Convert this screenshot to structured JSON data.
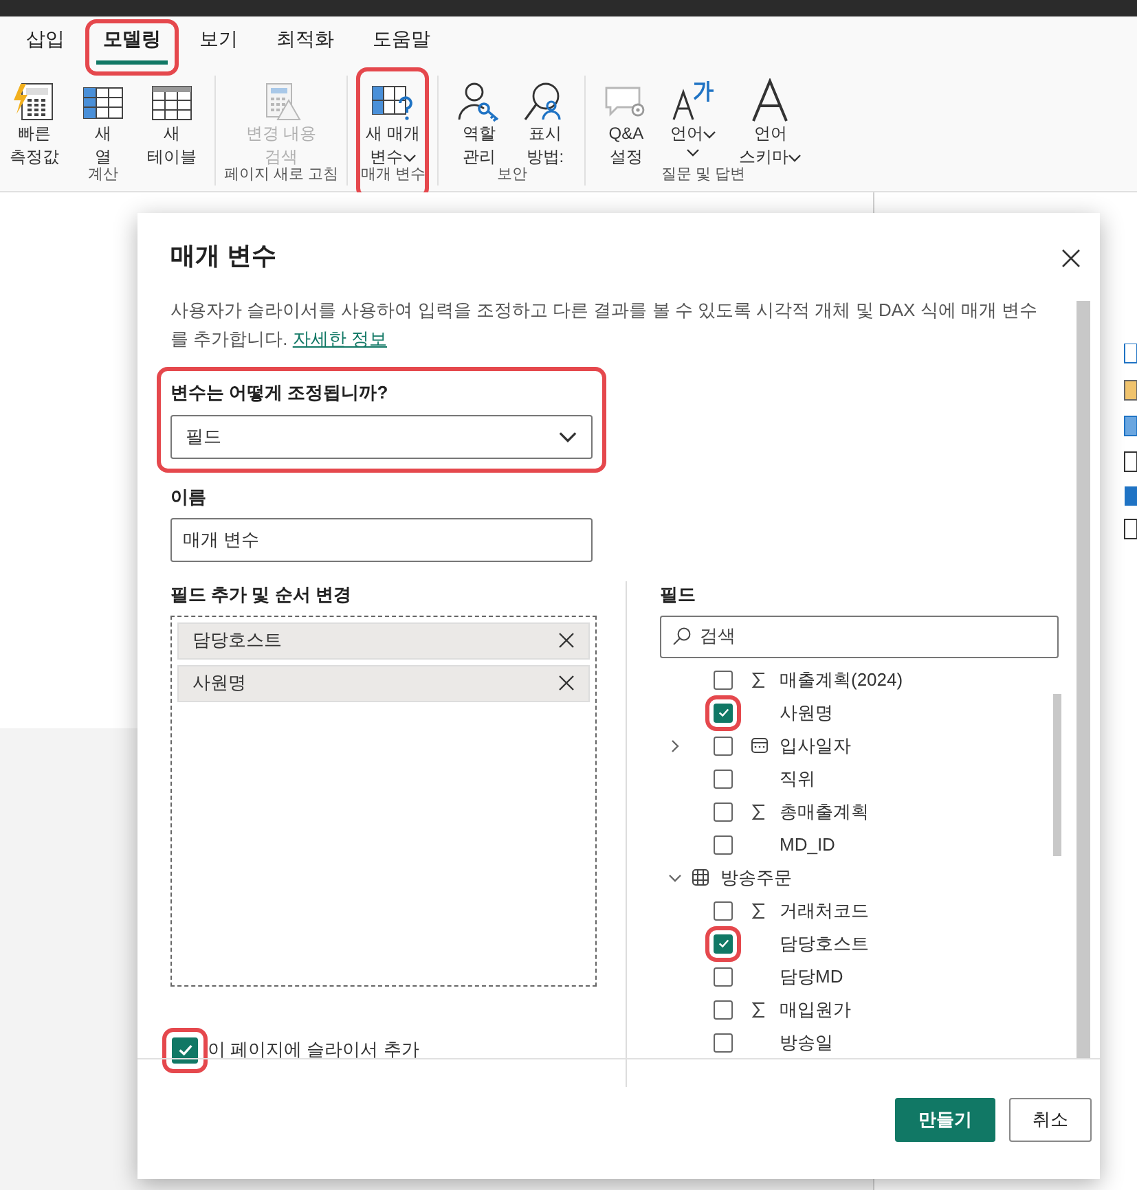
{
  "tabs": [
    {
      "label": "삽입",
      "selected": false,
      "highlighted": false
    },
    {
      "label": "모델링",
      "selected": true,
      "highlighted": true
    },
    {
      "label": "보기",
      "selected": false,
      "highlighted": false
    },
    {
      "label": "최적화",
      "selected": false,
      "highlighted": false
    },
    {
      "label": "도움말",
      "selected": false,
      "highlighted": false
    }
  ],
  "ribbon_groups": [
    {
      "label": "계산",
      "buttons": [
        {
          "kind": "quick-measure",
          "lines": [
            "빠른",
            "측정값"
          ],
          "disabled": false,
          "dropdown": false,
          "highlighted": false
        },
        {
          "kind": "new-column",
          "lines": [
            "새",
            "열"
          ],
          "disabled": false,
          "dropdown": false,
          "highlighted": false
        },
        {
          "kind": "new-table",
          "lines": [
            "새",
            "테이블"
          ],
          "disabled": false,
          "dropdown": false,
          "highlighted": false
        }
      ]
    },
    {
      "label": "페이지 새로 고침",
      "buttons": [
        {
          "kind": "detect-changes",
          "lines": [
            "변경 내용",
            "검색"
          ],
          "disabled": true,
          "dropdown": false,
          "highlighted": false
        }
      ]
    },
    {
      "label": "매개 변수",
      "buttons": [
        {
          "kind": "new-parameter",
          "lines": [
            "새 매개",
            "변수"
          ],
          "disabled": false,
          "dropdown": true,
          "highlighted": true
        }
      ]
    },
    {
      "label": "보안",
      "buttons": [
        {
          "kind": "manage-roles",
          "lines": [
            "역할",
            "관리"
          ],
          "disabled": false,
          "dropdown": false,
          "highlighted": false
        },
        {
          "kind": "view-as",
          "lines": [
            "표시",
            "방법:"
          ],
          "disabled": false,
          "dropdown": false,
          "highlighted": false
        }
      ]
    },
    {
      "label": "질문 및 답변",
      "buttons": [
        {
          "kind": "qa-setup",
          "lines": [
            "Q&A",
            "설정"
          ],
          "disabled": false,
          "dropdown": false,
          "highlighted": false
        },
        {
          "kind": "language",
          "lines": [
            "언어"
          ],
          "disabled": false,
          "dropdown": true,
          "highlighted": false
        },
        {
          "kind": "linguistic-schema",
          "lines": [
            "언어",
            "스키마"
          ],
          "disabled": false,
          "dropdown": true,
          "highlighted": false
        }
      ]
    }
  ],
  "dialog": {
    "title": "매개 변수",
    "description": "사용자가 슬라이서를 사용하여 입력을 조정하고 다른 결과를 볼 수 있도록 시각적 개체 및 DAX 식에 매개 변수를 추가합니다.",
    "link": "자세한 정보",
    "type_label": "변수는 어떻게 조정됩니까?",
    "type_value": "필드",
    "type_highlighted": true,
    "name_label": "이름",
    "name_value": "매개 변수",
    "order_label": "필드 추가 및 순서 변경",
    "selected_fields": [
      "담당호스트",
      "사원명"
    ],
    "add_slicer": {
      "label": "이 페이지에 슬라이서 추가",
      "checked": true,
      "highlighted": true
    },
    "fields_label": "필드",
    "search_placeholder": "검색",
    "field_tree": [
      {
        "kind": "sum",
        "label": "매출계획(2024)",
        "checked": false,
        "highlighted": false
      },
      {
        "kind": "text",
        "label": "사원명",
        "checked": true,
        "highlighted": true
      },
      {
        "kind": "date",
        "label": "입사일자",
        "checked": false,
        "highlighted": false,
        "expanded": false
      },
      {
        "kind": "text",
        "label": "직위",
        "checked": false,
        "highlighted": false
      },
      {
        "kind": "sum",
        "label": "총매출계획",
        "checked": false,
        "highlighted": false
      },
      {
        "kind": "text",
        "label": "MD_ID",
        "checked": false,
        "highlighted": false
      },
      {
        "kind": "table",
        "label": "방송주문",
        "expanded": true,
        "children": [
          {
            "kind": "sum",
            "label": "거래처코드",
            "checked": false,
            "highlighted": false
          },
          {
            "kind": "text",
            "label": "담당호스트",
            "checked": true,
            "highlighted": true
          },
          {
            "kind": "text",
            "label": "담당MD",
            "checked": false,
            "highlighted": false
          },
          {
            "kind": "sum",
            "label": "매입원가",
            "checked": false,
            "highlighted": false
          },
          {
            "kind": "text",
            "label": "방송일",
            "checked": false,
            "highlighted": false
          }
        ]
      }
    ],
    "buttons": [
      {
        "kind": "primary",
        "label": "만들기"
      },
      {
        "kind": "secondary",
        "label": "취소"
      }
    ]
  }
}
